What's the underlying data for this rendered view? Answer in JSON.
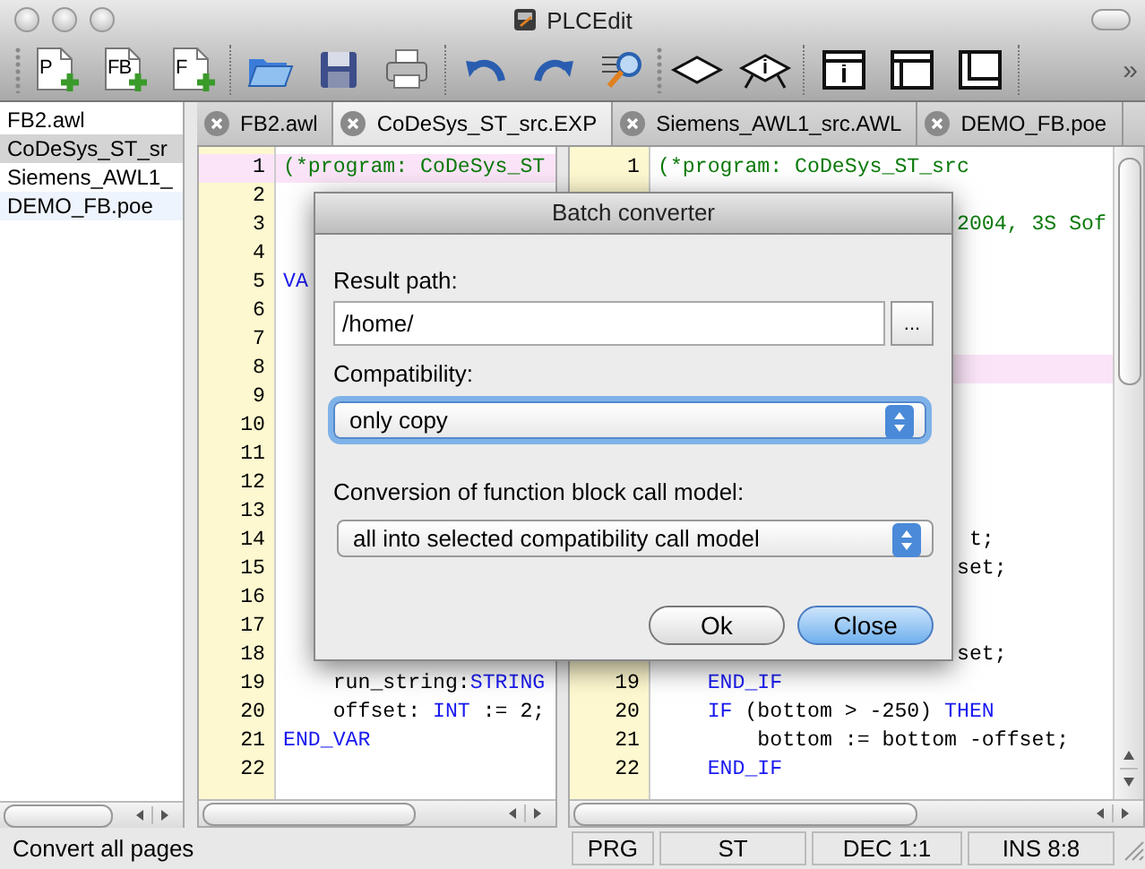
{
  "window": {
    "title": "PLCEdit"
  },
  "toolbar": {
    "groups": [
      [
        {
          "kind": "new-doc",
          "label": "P"
        },
        {
          "kind": "new-doc",
          "label": "FB"
        },
        {
          "kind": "new-doc",
          "label": "F"
        }
      ],
      [
        {
          "kind": "open"
        },
        {
          "kind": "save"
        },
        {
          "kind": "print"
        }
      ],
      [
        {
          "kind": "undo"
        },
        {
          "kind": "redo"
        },
        {
          "kind": "find"
        }
      ],
      [
        {
          "kind": "diamond"
        },
        {
          "kind": "diamond-info"
        }
      ],
      [
        {
          "kind": "panel-info"
        },
        {
          "kind": "panel-top"
        },
        {
          "kind": "panel-bottom"
        }
      ]
    ],
    "overflow": "»"
  },
  "files": [
    {
      "name": "FB2.awl",
      "selected": false
    },
    {
      "name": "CoDeSys_ST_sr",
      "selected": true
    },
    {
      "name": "Siemens_AWL1_",
      "selected": false
    },
    {
      "name": "DEMO_FB.poe",
      "selected": false
    }
  ],
  "tabs": [
    {
      "label": "FB2.awl",
      "selected": false
    },
    {
      "label": "CoDeSys_ST_src.EXP",
      "selected": true
    },
    {
      "label": "Siemens_AWL1_src.AWL",
      "selected": false
    },
    {
      "label": "DEMO_FB.poe",
      "selected": false
    }
  ],
  "editors": [
    {
      "lines": [
        {
          "number": "1",
          "highlighted": true,
          "code": [
            {
              "text": "(*program: CoDeSys_ST",
              "kind": "comment"
            }
          ]
        },
        {
          "number": "2",
          "highlighted": false
        },
        {
          "number": "3",
          "highlighted": false
        },
        {
          "number": "4",
          "highlighted": false
        },
        {
          "number": "5",
          "highlighted": false,
          "code": [
            {
              "text": "VA",
              "kind": "keyword"
            }
          ]
        },
        {
          "number": "6",
          "highlighted": false
        },
        {
          "number": "7",
          "highlighted": false
        },
        {
          "number": "8",
          "highlighted": false
        },
        {
          "number": "9",
          "highlighted": false
        },
        {
          "number": "10",
          "highlighted": false
        },
        {
          "number": "11",
          "highlighted": false
        },
        {
          "number": "12",
          "highlighted": false
        },
        {
          "number": "13",
          "highlighted": false
        },
        {
          "number": "14",
          "highlighted": false
        },
        {
          "number": "15",
          "highlighted": false
        },
        {
          "number": "16",
          "highlighted": false
        },
        {
          "number": "17",
          "highlighted": false
        },
        {
          "number": "18",
          "highlighted": false
        },
        {
          "number": "19",
          "highlighted": false,
          "code": [
            {
              "text": "    run_string:",
              "kind": "plain"
            },
            {
              "text": "STRING",
              "kind": "keyword"
            }
          ]
        },
        {
          "number": "20",
          "highlighted": false,
          "code": [
            {
              "text": "    offset: ",
              "kind": "plain"
            },
            {
              "text": "INT",
              "kind": "keyword"
            },
            {
              "text": " := 2;",
              "kind": "plain"
            }
          ]
        },
        {
          "number": "21",
          "highlighted": false,
          "code": [
            {
              "text": "END_VAR",
              "kind": "keyword"
            }
          ]
        },
        {
          "number": "22",
          "highlighted": false
        }
      ]
    },
    {
      "lines": [
        {
          "number": "1",
          "highlighted": false,
          "code": [
            {
              "text": "(*program: CoDeSys_ST_src",
              "kind": "comment"
            }
          ]
        },
        {
          "highlighted": false
        },
        {
          "highlighted": false,
          "code": [
            {
              "text": "                        2004, 3S Sof",
              "kind": "comment"
            }
          ]
        },
        {
          "highlighted": false
        },
        {
          "highlighted": false
        },
        {
          "highlighted": false
        },
        {
          "highlighted": false
        },
        {
          "highlighted": true
        },
        {
          "highlighted": false
        },
        {
          "highlighted": false
        },
        {
          "highlighted": false
        },
        {
          "highlighted": false
        },
        {
          "highlighted": false
        },
        {
          "highlighted": false,
          "code": [
            {
              "text": "                         t;",
              "kind": "plain"
            }
          ]
        },
        {
          "highlighted": false,
          "code": [
            {
              "text": "                        set;",
              "kind": "plain"
            }
          ]
        },
        {
          "highlighted": false
        },
        {
          "highlighted": false
        },
        {
          "highlighted": false,
          "code": [
            {
              "text": "                        set;",
              "kind": "plain"
            }
          ]
        },
        {
          "number": "19",
          "highlighted": false,
          "code": [
            {
              "text": "    END_IF",
              "kind": "keyword"
            }
          ]
        },
        {
          "number": "20",
          "highlighted": false,
          "code": [
            {
              "text": "    IF",
              "kind": "keyword"
            },
            {
              "text": " (bottom > -250) ",
              "kind": "plain"
            },
            {
              "text": "THEN",
              "kind": "keyword"
            }
          ]
        },
        {
          "number": "21",
          "highlighted": false,
          "code": [
            {
              "text": "        bottom := bottom -offset;",
              "kind": "plain"
            }
          ]
        },
        {
          "number": "22",
          "highlighted": false,
          "code": [
            {
              "text": "    END_IF",
              "kind": "keyword"
            }
          ]
        }
      ]
    }
  ],
  "dialog": {
    "title": "Batch converter",
    "result_path": {
      "label": "Result path:",
      "value": "/home/",
      "browse": "..."
    },
    "compatibility": {
      "label": "Compatibility:",
      "value": "only copy",
      "focused": true
    },
    "call_model": {
      "label": "Conversion of function block call model:",
      "value": "all into selected compatibility call model",
      "focused": false
    },
    "buttons": [
      {
        "label": "Ok",
        "default": false
      },
      {
        "label": "Close",
        "default": true
      }
    ]
  },
  "status_bar": {
    "message": "Convert all pages",
    "fields": [
      "PRG",
      "ST",
      "DEC 1:1",
      "INS 8:8"
    ]
  }
}
